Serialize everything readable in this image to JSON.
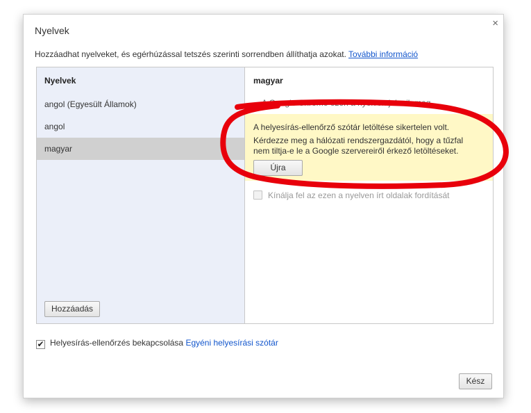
{
  "dialog": {
    "title": "Nyelvek",
    "close_icon": "×",
    "intro": "Hozzáadhat nyelveket, és egérhúzással tetszés szerinti sorrendben állíthatja azokat.",
    "more_info_link": "További információ"
  },
  "languages": {
    "header": "Nyelvek",
    "items": [
      "angol (Egyesült Államok)",
      "angol",
      "magyar"
    ],
    "selected": "magyar",
    "add_button": "Hozzáadás"
  },
  "details": {
    "header": "magyar",
    "chrome_note": "A Google Chrome ezen a nyelven jelenik meg",
    "warning": {
      "line1": "A helyesírás-ellenőrző szótár letöltése sikertelen volt.",
      "line2": "Kérdezze meg a hálózati rendszergazdától, hogy a tűzfal nem tiltja-e le a Google szervereiről érkező letöltéseket.",
      "retry_button": "Újra"
    },
    "translate_checkbox_label": "Kínálja fel az ezen a nyelven írt oldalak fordítását",
    "translate_checked": false
  },
  "footer": {
    "spellcheck_label": "Helyesírás-ellenőrzés bekapcsolása",
    "spellcheck_checked": true,
    "check_mark": "✔",
    "custom_dictionary_link": "Egyéni helyesírási szótár",
    "done_button": "Kész"
  },
  "colors": {
    "link": "#1155cc",
    "warning_bg": "#fff8c6",
    "left_panel_bg": "#ebeff9",
    "annotation_red": "#e8000b"
  },
  "annotation": "red-hand-drawn-circle"
}
